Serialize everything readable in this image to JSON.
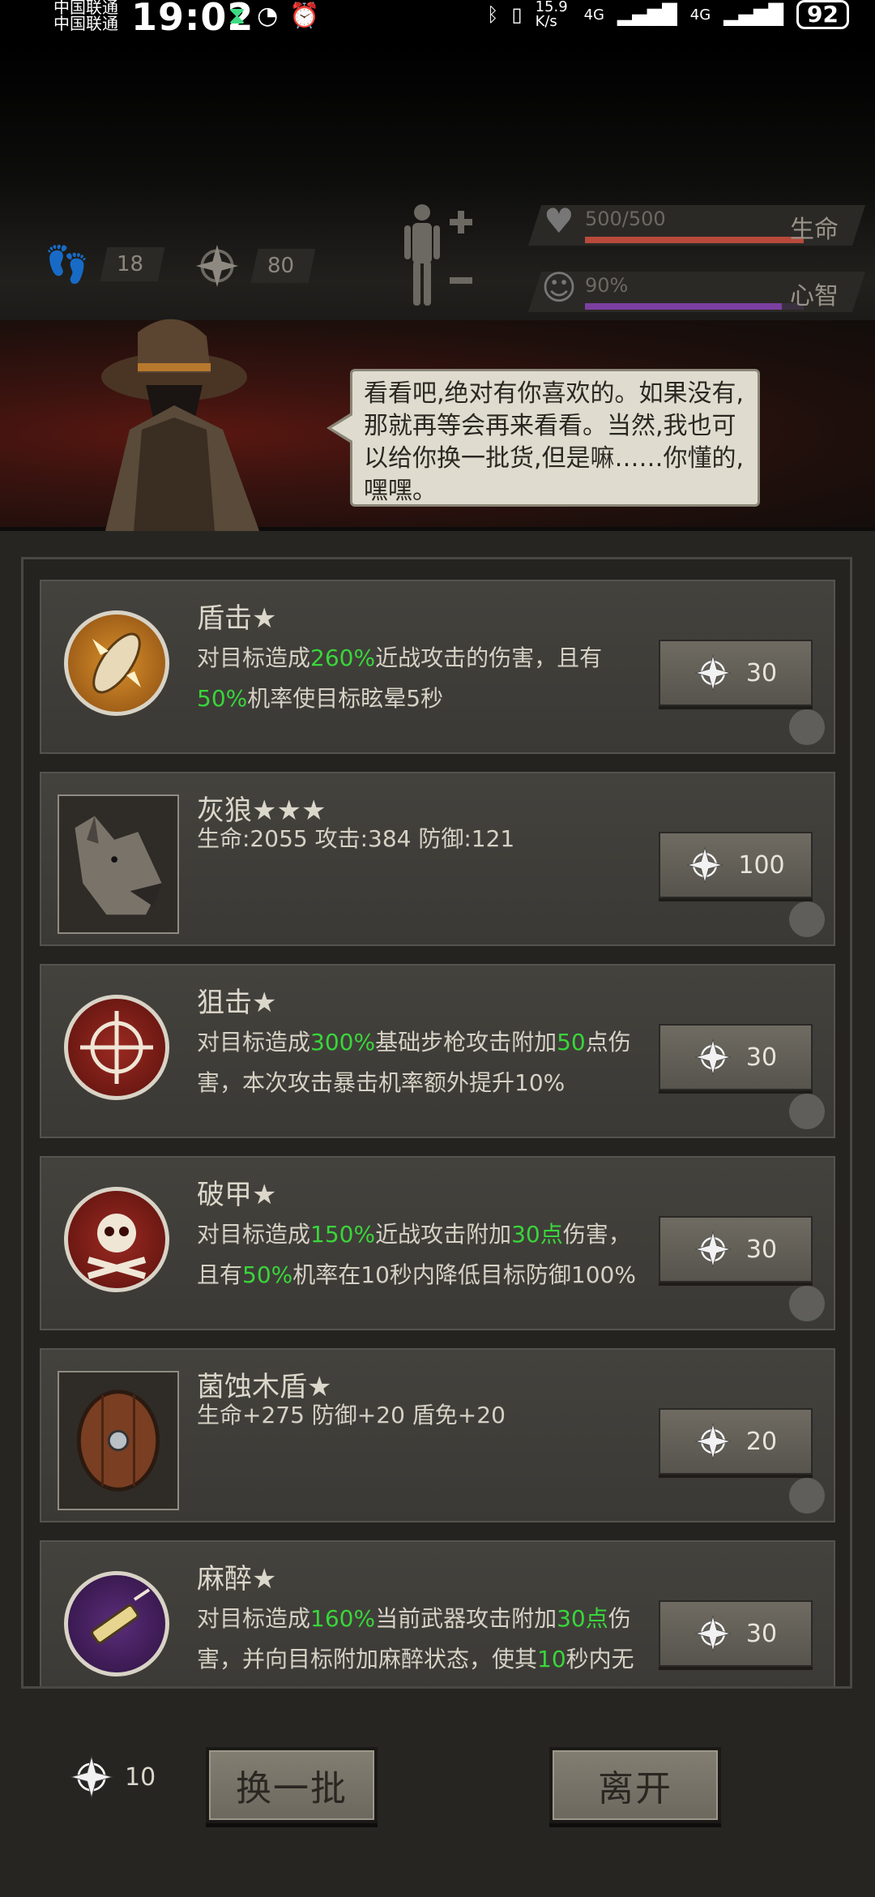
{
  "status_bar": {
    "carrier_top": "中国联通",
    "carrier": "中国联通",
    "time": "19:02",
    "net_speed": "15.9 K/s",
    "net_type_1": "4G",
    "net_type_2": "4G",
    "battery": "92"
  },
  "header": {
    "steps": "18",
    "compass_points": "80",
    "health_text": "500/500",
    "health_label": "生命",
    "health_fraction": 1.0,
    "sanity_text": "90%",
    "sanity_label": "心智",
    "sanity_fraction": 0.9
  },
  "npc": {
    "dialog": "看看吧,绝对有你喜欢的。如果没有,那就再等会再来看看。当然,我也可以给你换一批货,但是嘛……你懂的,嘿嘿。"
  },
  "items": [
    {
      "title": "盾击★",
      "desc_parts": [
        "对目标造成",
        "260%",
        "近战攻击的伤害，且有",
        "50%",
        "机率使目标眩晕5秒"
      ],
      "price": "30",
      "icon": "shield-bash-icon"
    },
    {
      "title": "灰狼★★★",
      "desc_parts": [
        "生命:2055  攻击:384  防御:121"
      ],
      "price": "100",
      "icon": "grey-wolf-portrait"
    },
    {
      "title": "狙击★",
      "desc_parts": [
        "对目标造成",
        "300%",
        "基础步枪攻击附加",
        "50",
        "点伤害，本次攻击暴击机率额外提升10%"
      ],
      "price": "30",
      "icon": "sniper-crosshair-icon"
    },
    {
      "title": "破甲★",
      "desc_parts": [
        "对目标造成",
        "150%",
        "近战攻击附加",
        "30点",
        "伤害，且有",
        "50%",
        "机率在10秒内降低目标防御100%"
      ],
      "price": "30",
      "icon": "skull-crossbones-icon"
    },
    {
      "title": "菌蚀木盾★",
      "desc_parts": [
        "生命+275  防御+20  盾免+20"
      ],
      "price": "20",
      "icon": "wooden-shield-icon"
    },
    {
      "title": "麻醉★",
      "desc_parts": [
        "对目标造成",
        "160%",
        "当前武器攻击附加",
        "30点",
        "伤害，并向目标附加麻醉状态，使其",
        "10",
        "秒内无法进行任何操作"
      ],
      "price": "30",
      "icon": "syringe-icon"
    }
  ],
  "footer": {
    "coins": "10",
    "refresh_label": "换一批",
    "leave_label": "离开"
  },
  "colors": {
    "highlight": "#39d63a",
    "health": "#b84a3c",
    "sanity": "#7b3fa0"
  }
}
